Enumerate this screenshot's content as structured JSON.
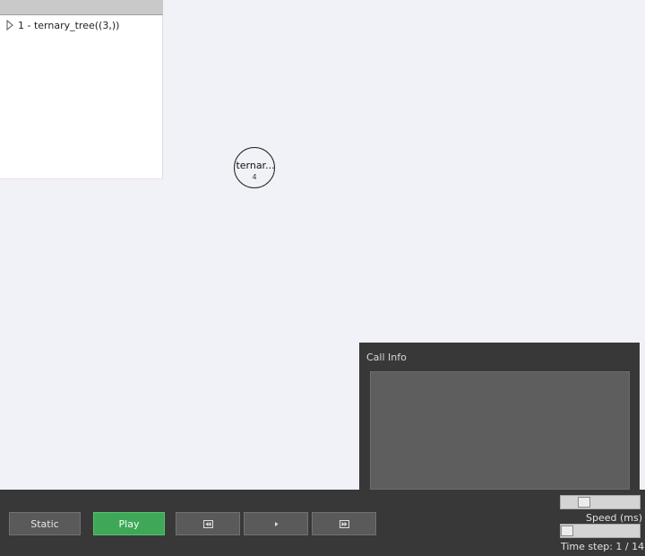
{
  "tree": {
    "items": [
      {
        "label": "1 - ternary_tree((3,))"
      }
    ]
  },
  "canvas": {
    "node": {
      "name": "ternar...",
      "count": "4"
    }
  },
  "call_info": {
    "title": "Call Info"
  },
  "controls": {
    "static_label": "Static",
    "play_label": "Play",
    "speed_label": "Speed (ms)",
    "speed_level": 0.25,
    "time_step_label": "Time step: 1 / 14",
    "time_step_current": 1,
    "time_step_total": 14
  },
  "colors": {
    "background": "#f1f2f8",
    "panel_dark": "#383838",
    "play_green": "#3ea858",
    "button_gray": "#5a5a5a"
  },
  "icons": {
    "expand": "triangle-right-icon",
    "rewind": "skip-back-icon",
    "step": "play-small-icon",
    "forward": "skip-forward-icon"
  }
}
